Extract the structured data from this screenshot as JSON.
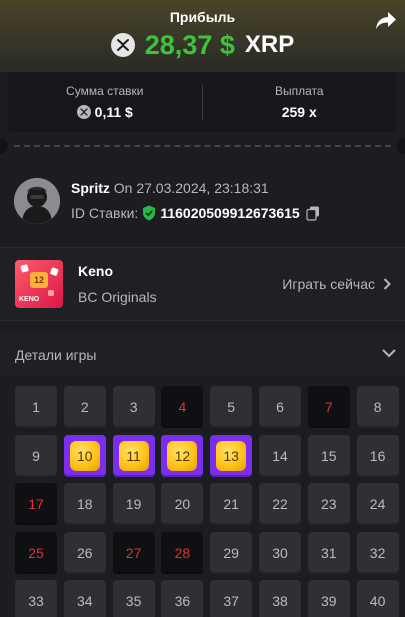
{
  "header": {
    "title": "Прибыль",
    "amount": "28,37 $",
    "currency": "XRP",
    "coin_icon": "xrp-coin-icon",
    "share_icon": "share-icon",
    "amount_color": "#3cc43a"
  },
  "stats": {
    "bet_label": "Сумма ставки",
    "bet_value": "0,11 $",
    "payout_label": "Выплата",
    "payout_value": "259 x"
  },
  "user": {
    "name": "Spritz",
    "date_text": "On 27.03.2024, 23:18:31",
    "bet_id_label": "ID Ставки:",
    "bet_id": "116020509912673615"
  },
  "game": {
    "thumb_number": "12",
    "thumb_label": "KENO",
    "name": "Keno",
    "provider": "BC Originals",
    "play_label": "Играть сейчас"
  },
  "details": {
    "title": "Детали игры"
  },
  "board": {
    "numbers": [
      1,
      2,
      3,
      4,
      5,
      6,
      7,
      8,
      9,
      10,
      11,
      12,
      13,
      14,
      15,
      16,
      17,
      18,
      19,
      20,
      21,
      22,
      23,
      24,
      25,
      26,
      27,
      28,
      29,
      30,
      31,
      32,
      33,
      34,
      35,
      36,
      37,
      38,
      39,
      40
    ],
    "drawn_miss": [
      4,
      7,
      17,
      25,
      27,
      28
    ],
    "hits": [
      10,
      11,
      12,
      13
    ],
    "colors": {
      "tile": "#2e3036",
      "miss": "#0f1012",
      "miss_text": "#e0313c",
      "hit_border": "#7a2ff0",
      "hit_gem": "#ffc21a"
    }
  }
}
